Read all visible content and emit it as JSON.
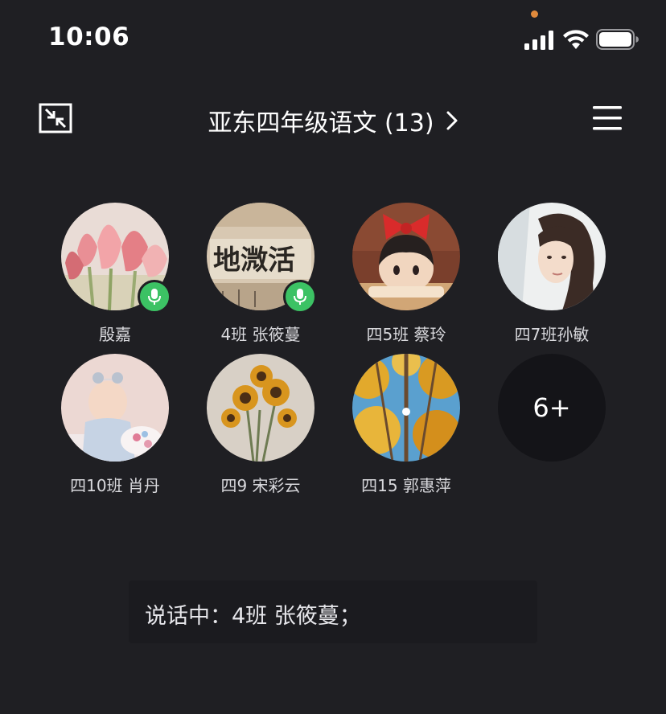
{
  "status_bar": {
    "time": "10:06",
    "icons": [
      "signal-icon",
      "wifi-icon",
      "battery-icon"
    ]
  },
  "nav": {
    "title": "亚东四年级语文 (13)",
    "left_icon": "minimize-icon",
    "right_icon": "menu-icon",
    "title_icon": "chevron-right-icon"
  },
  "members": [
    {
      "name": "殷嘉",
      "speaking": true,
      "avatar": "tulips"
    },
    {
      "name": "4班 张筱蔓",
      "speaking": true,
      "avatar": "calligraphy"
    },
    {
      "name": "四5班 蔡玲",
      "speaking": false,
      "avatar": "anime-girl"
    },
    {
      "name": "四7班孙敏",
      "speaking": false,
      "avatar": "portrait"
    },
    {
      "name": "四10班 肖丹",
      "speaking": false,
      "avatar": "baby"
    },
    {
      "name": "四9 宋彩云",
      "speaking": false,
      "avatar": "sunflowers"
    },
    {
      "name": "四15 郭惠萍",
      "speaking": false,
      "avatar": "autumn-trees"
    }
  ],
  "more_members": "6+",
  "speaking_banner": "说话中：4班 张筱蔓；",
  "colors": {
    "background": "#1f1f23",
    "mic_badge": "#3cc264",
    "privacy_dot": "#e08a3c"
  }
}
